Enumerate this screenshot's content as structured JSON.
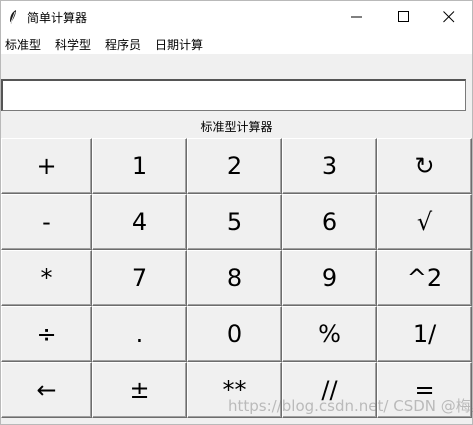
{
  "window": {
    "title": "简单计算器"
  },
  "menu": [
    "标准型",
    "科学型",
    "程序员",
    "日期计算"
  ],
  "display": {
    "value": ""
  },
  "mode_label": "标准型计算器",
  "keys": [
    [
      "+",
      "1",
      "2",
      "3",
      "↻"
    ],
    [
      "-",
      "4",
      "5",
      "6",
      "√"
    ],
    [
      "*",
      "7",
      "8",
      "9",
      "^2"
    ],
    [
      "÷",
      ".",
      "0",
      "%",
      "1/"
    ],
    [
      "←",
      "±",
      "**",
      "//",
      "="
    ]
  ],
  "watermark": "https://blog.csdn.net/  CSDN @梅里雪山GIS"
}
